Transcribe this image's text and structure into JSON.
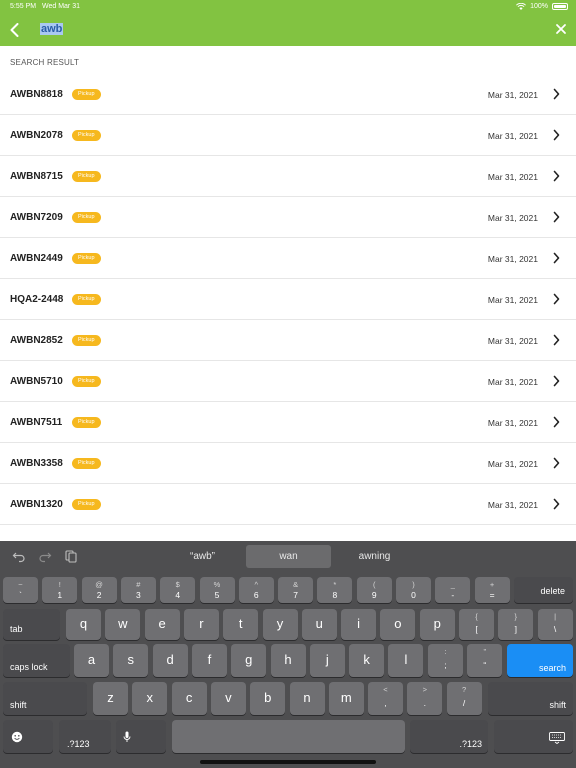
{
  "status_bar": {
    "time": "5:55 PM",
    "date": "Wed Mar 31",
    "battery": "100%"
  },
  "header": {
    "search_value": "awb",
    "bg_color": "#82c341"
  },
  "section_label": "SEARCH RESULT",
  "results": [
    {
      "id": "AWBN8818",
      "badge": "Pickup",
      "date": "Mar 31, 2021"
    },
    {
      "id": "AWBN2078",
      "badge": "Pickup",
      "date": "Mar 31, 2021"
    },
    {
      "id": "AWBN8715",
      "badge": "Pickup",
      "date": "Mar 31, 2021"
    },
    {
      "id": "AWBN7209",
      "badge": "Pickup",
      "date": "Mar 31, 2021"
    },
    {
      "id": "AWBN2449",
      "badge": "Pickup",
      "date": "Mar 31, 2021"
    },
    {
      "id": "HQA2-2448",
      "badge": "Pickup",
      "date": "Mar 31, 2021"
    },
    {
      "id": "AWBN2852",
      "badge": "Pickup",
      "date": "Mar 31, 2021"
    },
    {
      "id": "AWBN5710",
      "badge": "Pickup",
      "date": "Mar 31, 2021"
    },
    {
      "id": "AWBN7511",
      "badge": "Pickup",
      "date": "Mar 31, 2021"
    },
    {
      "id": "AWBN3358",
      "badge": "Pickup",
      "date": "Mar 31, 2021"
    },
    {
      "id": "AWBN1320",
      "badge": "Pickup",
      "date": "Mar 31, 2021"
    }
  ],
  "keyboard": {
    "suggestions": [
      "“awb”",
      "wan",
      "awning"
    ],
    "number_row": [
      {
        "top": "~",
        "bottom": "`"
      },
      {
        "top": "!",
        "bottom": "1"
      },
      {
        "top": "@",
        "bottom": "2"
      },
      {
        "top": "#",
        "bottom": "3"
      },
      {
        "top": "$",
        "bottom": "4"
      },
      {
        "top": "%",
        "bottom": "5"
      },
      {
        "top": "^",
        "bottom": "6"
      },
      {
        "top": "&",
        "bottom": "7"
      },
      {
        "top": "*",
        "bottom": "8"
      },
      {
        "top": "(",
        "bottom": "9"
      },
      {
        "top": ")",
        "bottom": "0"
      },
      {
        "top": "_",
        "bottom": "-"
      },
      {
        "top": "+",
        "bottom": "="
      }
    ],
    "delete": "delete",
    "tab": "tab",
    "row_q": [
      "q",
      "w",
      "e",
      "r",
      "t",
      "y",
      "u",
      "i",
      "o",
      "p"
    ],
    "row_q_extra": [
      {
        "top": "{",
        "bottom": "["
      },
      {
        "top": "}",
        "bottom": "]"
      },
      {
        "top": "|",
        "bottom": "\\"
      }
    ],
    "caps_lock": "caps lock",
    "row_a": [
      "a",
      "s",
      "d",
      "f",
      "g",
      "h",
      "j",
      "k",
      "l"
    ],
    "row_a_extra": [
      {
        "top": ":",
        "bottom": ";"
      },
      {
        "top": "”",
        "bottom": "“"
      }
    ],
    "search": "search",
    "shift": "shift",
    "row_z": [
      "z",
      "x",
      "c",
      "v",
      "b",
      "n",
      "m"
    ],
    "row_z_extra": [
      {
        "top": "<",
        "bottom": ","
      },
      {
        "top": ">",
        "bottom": "."
      },
      {
        "top": "?",
        "bottom": "/"
      }
    ],
    "numbers_key": ".?123"
  }
}
